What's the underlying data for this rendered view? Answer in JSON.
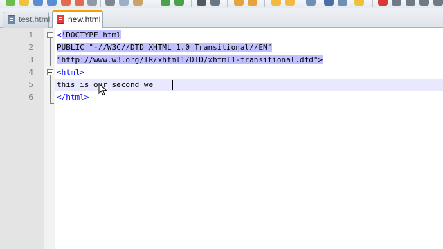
{
  "tabs": [
    {
      "label": "test.html",
      "icon": "html-file-icon",
      "active": false
    },
    {
      "label": "new.html",
      "icon": "html-file-icon",
      "active": true
    }
  ],
  "editor": {
    "lines": [
      {
        "number": "1",
        "text_a": "<",
        "text_b": "!DOCTYPE html",
        "fold": "open"
      },
      {
        "number": "2",
        "text": "PUBLIC \"-//W3C//DTD XHTML 1.0 Transitional//EN\""
      },
      {
        "number": "3",
        "text": "\"http://www.w3.org/TR/xhtml1/DTD/xhtml1-transitional.dtd\">"
      },
      {
        "number": "4",
        "text": "<html>",
        "fold": "open"
      },
      {
        "number": "5",
        "text": "this is our second we"
      },
      {
        "number": "6",
        "text": "</html>"
      }
    ]
  },
  "colors": {
    "selection": "#c0c0ff",
    "tag": "#0000ff",
    "current_line": "#e8e8ff",
    "active_tab_accent": "#f5a000"
  }
}
